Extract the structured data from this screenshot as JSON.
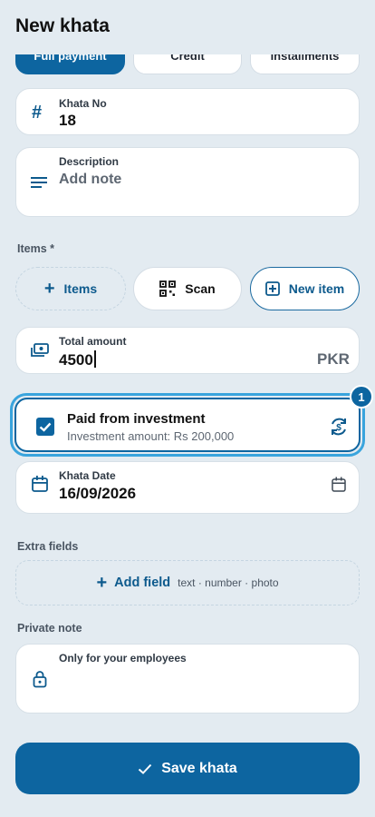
{
  "header": {
    "title": "New khata"
  },
  "payment_tabs": [
    {
      "label": "Full payment",
      "active": true
    },
    {
      "label": "Credit",
      "active": false
    },
    {
      "label": "Installments",
      "active": false
    }
  ],
  "khata_no": {
    "label": "Khata No",
    "value": "18"
  },
  "description": {
    "label": "Description",
    "placeholder": "Add note"
  },
  "items": {
    "section_label": "Items *",
    "add_label": "Items",
    "scan_label": "Scan",
    "new_item_label": "New item"
  },
  "total_amount": {
    "label": "Total amount",
    "value": "4500",
    "currency": "PKR"
  },
  "investment": {
    "title": "Paid from investment",
    "subtitle": "Investment amount: Rs 200,000",
    "checked": true,
    "badge": "1"
  },
  "khata_date": {
    "label": "Khata Date",
    "value": "16/09/2026"
  },
  "extra_fields": {
    "section_label": "Extra fields",
    "add_label": "Add field",
    "hint": "text · number · photo"
  },
  "private_note": {
    "section_label": "Private note",
    "label": "Only for your employees"
  },
  "save": {
    "label": "Save khata"
  },
  "colors": {
    "accent": "#0d65a0",
    "background": "#e3ebf1",
    "highlight": "#39a4dd"
  }
}
